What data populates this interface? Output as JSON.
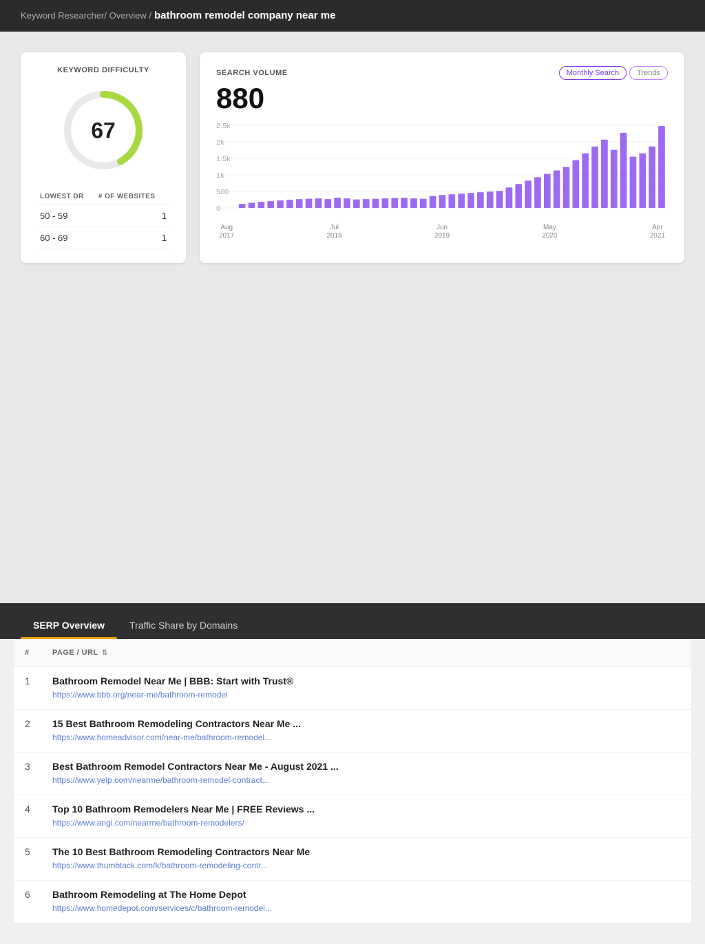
{
  "breadcrumb": {
    "base": "Keyword Researcher/ Overview /",
    "keyword": "bathroom remodel company near me"
  },
  "keyword_difficulty": {
    "title": "KEYWORD DIFFICULTY",
    "score": "67",
    "table": {
      "col1": "LOWEST DR",
      "col2": "# OF WEBSITES",
      "rows": [
        {
          "range": "50 - 59",
          "count": "1"
        },
        {
          "range": "60 - 69",
          "count": "1"
        }
      ]
    }
  },
  "search_volume": {
    "title": "SEARCH VOLUME",
    "value": "880",
    "tabs": [
      {
        "label": "Monthly Search",
        "active": true
      },
      {
        "label": "Trends",
        "active": false
      }
    ],
    "chart": {
      "y_labels": [
        "2.5k",
        "2k",
        "1.5k",
        "1k",
        "500",
        "0"
      ],
      "x_labels": [
        {
          "line1": "Aug",
          "line2": "2017"
        },
        {
          "line1": "Jul",
          "line2": "2018"
        },
        {
          "line1": "Jun",
          "line2": "2019"
        },
        {
          "line1": "May",
          "line2": "2020"
        },
        {
          "line1": "Apr",
          "line2": "2021"
        }
      ],
      "bars": [
        120,
        150,
        180,
        200,
        220,
        240,
        260,
        270,
        280,
        260,
        300,
        280,
        250,
        260,
        270,
        280,
        290,
        300,
        280,
        270,
        350,
        380,
        400,
        420,
        440,
        460,
        480,
        500,
        600,
        700,
        800,
        900,
        1000,
        1100,
        1200,
        1400,
        1600,
        1800,
        2000,
        1700,
        2200,
        1500,
        1600,
        1800,
        2400
      ]
    }
  },
  "tabs": [
    {
      "label": "SERP Overview",
      "active": true
    },
    {
      "label": "Traffic Share by Domains",
      "active": false
    }
  ],
  "table": {
    "headers": [
      {
        "label": "#",
        "sortable": false
      },
      {
        "label": "PAGE / URL",
        "sortable": true
      }
    ],
    "rows": [
      {
        "num": "1",
        "title": "Bathroom Remodel Near Me | BBB: Start with Trust®",
        "url": "https://www.bbb.org/near-me/bathroom-remodel"
      },
      {
        "num": "2",
        "title": "15 Best Bathroom Remodeling Contractors Near Me ...",
        "url": "https://www.homeadvisor.com/near-me/bathroom-remodel..."
      },
      {
        "num": "3",
        "title": "Best Bathroom Remodel Contractors Near Me - August 2021 ...",
        "url": "https://www.yelp.com/nearme/bathroom-remodel-contract..."
      },
      {
        "num": "4",
        "title": "Top 10 Bathroom Remodelers Near Me | FREE Reviews ...",
        "url": "https://www.angi.com/nearme/bathroom-remodelers/"
      },
      {
        "num": "5",
        "title": "The 10 Best Bathroom Remodeling Contractors Near Me",
        "url": "https://www.thumbtack.com/k/bathroom-remodeling-contr..."
      },
      {
        "num": "6",
        "title": "Bathroom Remodeling at The Home Depot",
        "url": "https://www.homedepot.com/services/c/bathroom-remodel..."
      }
    ]
  }
}
